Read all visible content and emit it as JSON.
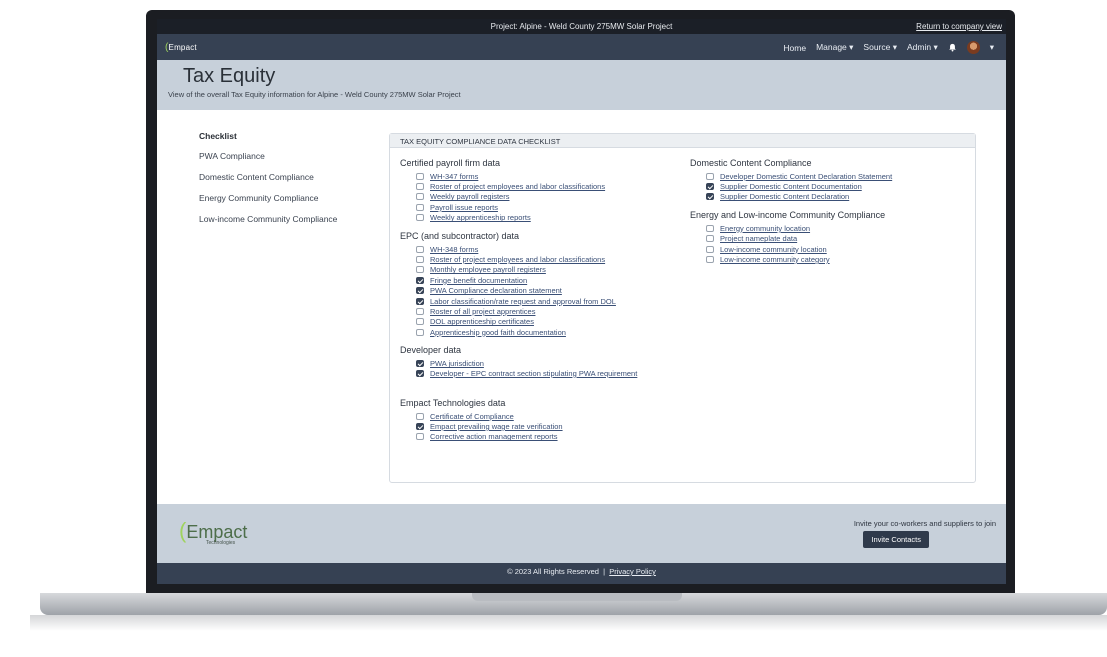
{
  "topbar": {
    "project": "Project: Alpine - Weld County 275MW Solar Project",
    "return_link": "Return to company view"
  },
  "nav": {
    "logo": "Empact",
    "items": [
      "Home",
      "Manage ▾",
      "Source ▾",
      "Admin ▾"
    ]
  },
  "header": {
    "title": "Tax Equity",
    "subtitle": "View of the overall Tax Equity information for Alpine - Weld County 275MW Solar Project"
  },
  "sidebar": {
    "title": "Checklist",
    "items": [
      "PWA Compliance",
      "Domestic Content Compliance",
      "Energy Community Compliance",
      "Low-income Community Compliance"
    ]
  },
  "card": {
    "title": "TAX EQUITY COMPLIANCE DATA CHECKLIST",
    "left": [
      {
        "title": "Certified payroll firm data",
        "items": [
          {
            "label": "WH-347 forms",
            "checked": false
          },
          {
            "label": "Roster of project employees and labor classifications",
            "checked": false
          },
          {
            "label": "Weekly payroll registers",
            "checked": false
          },
          {
            "label": "Payroll issue reports",
            "checked": false
          },
          {
            "label": "Weekly apprenticeship reports",
            "checked": false
          }
        ]
      },
      {
        "title": "EPC (and subcontractor) data",
        "items": [
          {
            "label": "WH-348 forms",
            "checked": false
          },
          {
            "label": "Roster of project employees and labor classifications",
            "checked": false
          },
          {
            "label": "Monthly employee payroll registers",
            "checked": false
          },
          {
            "label": "Fringe benefit documentation",
            "checked": true
          },
          {
            "label": "PWA Compliance declaration statement",
            "checked": true
          },
          {
            "label": "Labor classification/rate request and approval from DOL",
            "checked": true
          },
          {
            "label": "Roster of all project apprentices",
            "checked": false
          },
          {
            "label": "DOL apprenticeship certificates",
            "checked": false
          },
          {
            "label": "Apprenticeship good faith documentation",
            "checked": false
          }
        ]
      },
      {
        "title": "Developer data",
        "items": [
          {
            "label": "PWA jurisdiction",
            "checked": true
          },
          {
            "label": "Developer - EPC contract section stipulating PWA requirement",
            "checked": true
          }
        ]
      },
      {
        "title": "Empact Technologies data",
        "items": [
          {
            "label": "Certificate of Compliance",
            "checked": false
          },
          {
            "label": "Empact prevailing wage rate verification",
            "checked": true
          },
          {
            "label": "Corrective action management reports",
            "checked": false
          }
        ]
      }
    ],
    "right": [
      {
        "title": "Domestic Content Compliance",
        "items": [
          {
            "label": "Developer Domestic Content Declaration Statement",
            "checked": false
          },
          {
            "label": "Supplier Domestic Content Documentation",
            "checked": true
          },
          {
            "label": "Supplier Domestic Content Declaration",
            "checked": true
          }
        ]
      },
      {
        "title": "Energy and Low-income Community Compliance",
        "items": [
          {
            "label": "Energy community location",
            "checked": false
          },
          {
            "label": "Project nameplate data",
            "checked": false
          },
          {
            "label": "Low-income community location",
            "checked": false
          },
          {
            "label": "Low-income community category",
            "checked": false
          }
        ]
      }
    ]
  },
  "footer": {
    "logo_big": "Empact",
    "logo_small": "Technologies",
    "invite_text": "Invite your co-workers and suppliers to join",
    "invite_button": "Invite Contacts",
    "copyright": "© 2023 All Rights Reserved",
    "separator": "|",
    "privacy": "Privacy Policy"
  }
}
